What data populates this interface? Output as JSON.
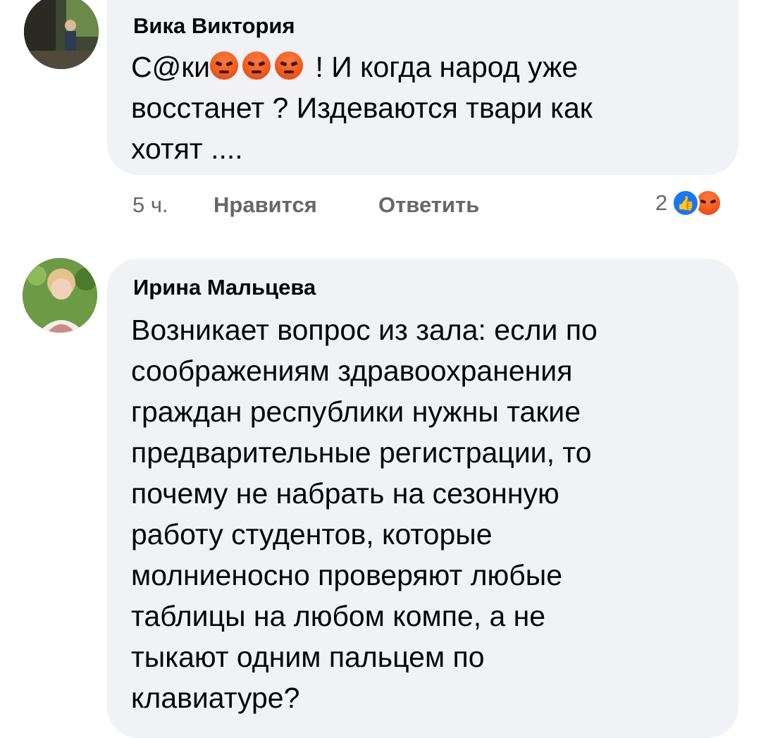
{
  "comments": [
    {
      "author": "Вика Виктория",
      "text_prefix": "С@ки",
      "emoji_count": 3,
      "text_suffix": " ! И когда народ уже",
      "lines": [
        "восстанет ? Издеваются твари как",
        "хотят ...."
      ],
      "time": "5 ч.",
      "like_label": "Нравится",
      "reply_label": "Ответить",
      "reaction_count": "2",
      "reaction_icons": [
        "like-icon",
        "angry-icon"
      ],
      "avatar_icon": "user-photo",
      "colors": {
        "like": "#1877f2",
        "angry": "#f25c1d"
      }
    },
    {
      "author": "Ирина Мальцева",
      "lines": [
        "Возникает вопрос из зала: если по",
        "соображениям здравоохранения",
        "граждан республики нужны такие",
        "предварительные  регистрации, то",
        "почему не набрать на сезонную",
        "работу студентов, которые",
        "молниеносно проверяют любые",
        "таблицы на любом компе, а не",
        "тыкают одним пальцем по",
        "клавиатуре?"
      ],
      "avatar_icon": "user-photo"
    }
  ],
  "colors": {
    "bubble": "#f0f2f5",
    "meta_text": "#65676b",
    "text": "#050505"
  }
}
